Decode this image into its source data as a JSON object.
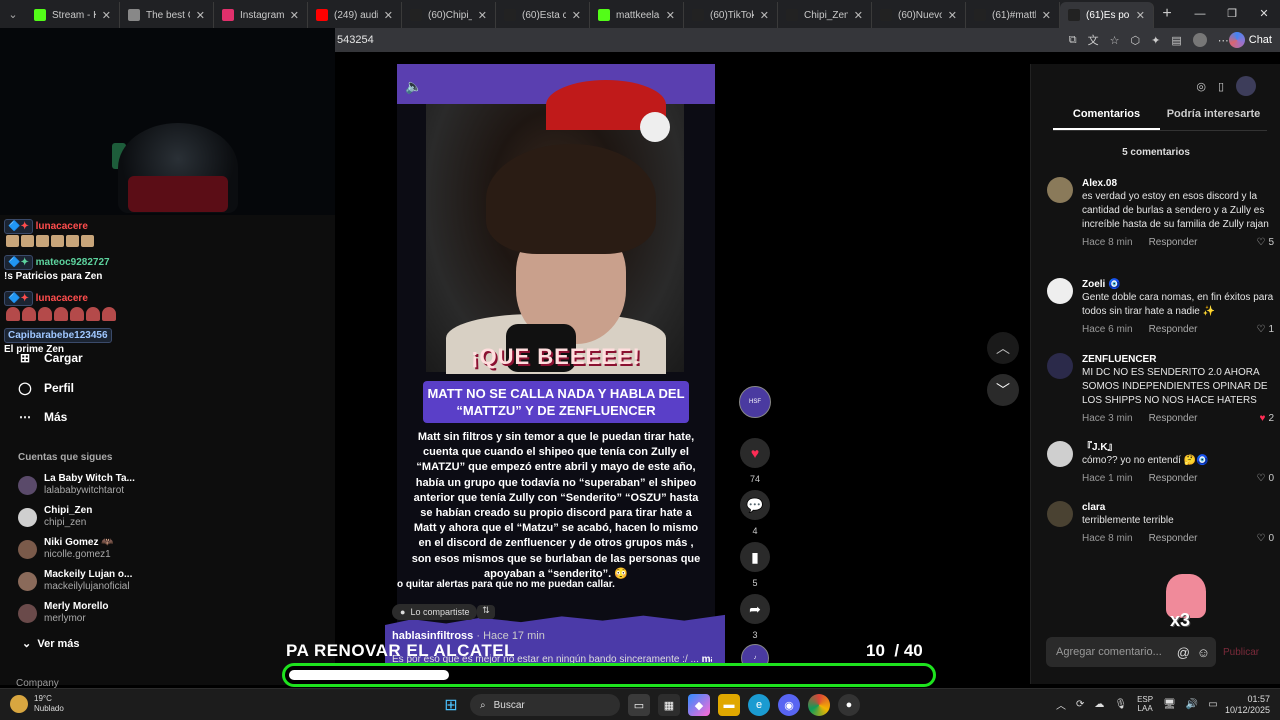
{
  "browser": {
    "tabs": [
      {
        "title": "Stream - Kick D",
        "icon": "kick-icon",
        "color": "#53fc18"
      },
      {
        "title": "The best ChatB",
        "icon": "chatbot-icon",
        "color": "#888888"
      },
      {
        "title": "Instagram",
        "icon": "instagram-icon",
        "color": "#e1306c"
      },
      {
        "title": "(249) audio FU",
        "icon": "youtube-icon",
        "color": "#ff0000"
      },
      {
        "title": "(60)Chipi_Zen (",
        "icon": "tiktok-icon",
        "color": "#222222"
      },
      {
        "title": "(60)Esta cuenta",
        "icon": "tiktok-icon",
        "color": "#222222"
      },
      {
        "title": "mattkeelan Stre",
        "icon": "kick-icon",
        "color": "#53fc18"
      },
      {
        "title": "(60)TikTok - Ma",
        "icon": "tiktok-icon",
        "color": "#222222"
      },
      {
        "title": "Chipi_Zen (@c",
        "icon": "tiktok-icon",
        "color": "#222222"
      },
      {
        "title": "(60)Nuevo ingr",
        "icon": "tiktok-icon",
        "color": "#222222"
      },
      {
        "title": "(61)#mattkeela",
        "icon": "tiktok-icon",
        "color": "#222222"
      },
      {
        "title": "(61)Es por eso",
        "icon": "tiktok-icon",
        "color": "#222222"
      }
    ],
    "url": "543254",
    "chat_label": "Chat"
  },
  "stream_chat": {
    "lines": [
      {
        "user": "lunacacere",
        "color": "#ff4d4d"
      },
      {
        "user": "mateoc9282727",
        "color": "#5dd39e"
      },
      {
        "text": "!s Patricios para Zen",
        "color": "#ffffff"
      },
      {
        "user": "lunacacere",
        "color": "#ff4d4d"
      },
      {
        "user": "Capibarabebe123456",
        "color": "#9fc7ff"
      },
      {
        "text": "El prime Zen",
        "color": "#ffffff"
      }
    ]
  },
  "sidebar": {
    "nav": [
      {
        "label": "Cargar",
        "icon": "upload-icon"
      },
      {
        "label": "Perfil",
        "icon": "profile-icon"
      },
      {
        "label": "Más",
        "icon": "more-icon"
      }
    ],
    "following_heading": "Cuentas que sigues",
    "following": [
      {
        "name": "La Baby Witch Ta...",
        "handle": "lalababywitchtarot"
      },
      {
        "name": "Chipi_Zen",
        "handle": "chipi_zen"
      },
      {
        "name": "Niki Gomez 🦇",
        "handle": "nicolle.gomez1"
      },
      {
        "name": "Mackeily Lujan o...",
        "handle": "mackeilylujanoficial"
      },
      {
        "name": "Merly Morello",
        "handle": "merlymor"
      }
    ],
    "see_more": "Ver más",
    "footer": "Company"
  },
  "video": {
    "sticker_text": "¡QUE BEEEEE!",
    "headline": "MATT NO SE CALLA NADA Y HABLA DEL “MATTZU” Y DE ZENFLUENCER",
    "body": "Matt sin filtros y sin temor a que le puedan tirar hate, cuenta que cuando el shipeo que tenía con Zully el “MATZU” que empezó entre abril y mayo de este año, había un grupo que todavía no “superaban” el shipeo anterior que tenía Zully con “Senderito” “OSZU” hasta se habían creado su propio discord para tirar hate a Matt y ahora que el “Matzu” se acabó, hacen lo mismo en el discord de zenfluencer y de otros grupos más , son esos mismos que se burlaban de las personas que apoyaban a “senderito”. 😳",
    "alert_line": "o quitar alertas para que no me puedan callar.",
    "share_label": "Lo compartiste",
    "author": "hablasinfiltross",
    "time": "· Hace 17 min",
    "caption": "Es por eso que es mejor no estar en ningún bando sinceramente :/ ...",
    "caption_more": "más",
    "actions": {
      "likes": "74",
      "comments": "4",
      "saves": "5",
      "shares": "3"
    }
  },
  "overlay": {
    "text": "PA RENOVAR EL ALCATEL",
    "counter_current": "10",
    "counter_total": "/ 40",
    "progress": 0.25,
    "progress_color": "#1ee31e"
  },
  "comments_panel": {
    "tabs": [
      "Comentarios",
      "Podría interesarte"
    ],
    "count": "5 comentarios",
    "reply_label": "Responder",
    "comments": [
      {
        "user": "Alex.08",
        "text": "es verdad yo estoy en esos discord y la cantidad de burlas a sendero y a Zully es increíble hasta de su familia de Zully rajan",
        "time": "Hace 8 min",
        "likes": "5",
        "liked": false
      },
      {
        "user": "Zoeli 🧿",
        "text": "Gente doble cara nomas, en fin éxitos para todos sin tirar hate a nadie ✨",
        "time": "Hace 6 min",
        "likes": "1",
        "liked": false
      },
      {
        "user": "ZENFLUENCER",
        "text": "MI DC NO ES SENDERITO 2.0 AHORA SOMOS INDEPENDIENTES OPINAR DE LOS SHIPPS NO NOS HACE HATERS",
        "time": "Hace 3 min",
        "likes": "2",
        "liked": true
      },
      {
        "user": "『J.K』",
        "text": "cómo?? yo no entendí 🤔🧿",
        "time": "Hace 1 min",
        "likes": "0",
        "liked": false
      },
      {
        "user": "clara",
        "text": "terriblemente terrible",
        "time": "Hace 8 min",
        "likes": "0",
        "liked": false
      }
    ],
    "input_placeholder": "Agregar comentario...",
    "post_label": "Publicar",
    "sticker_text": "x3"
  },
  "taskbar": {
    "temp": "19°C",
    "weather": "Nublado",
    "search_label": "Buscar",
    "lang_top": "ESP",
    "lang_bottom": "LAA",
    "time": "01:57",
    "date": "10/12/2025"
  }
}
